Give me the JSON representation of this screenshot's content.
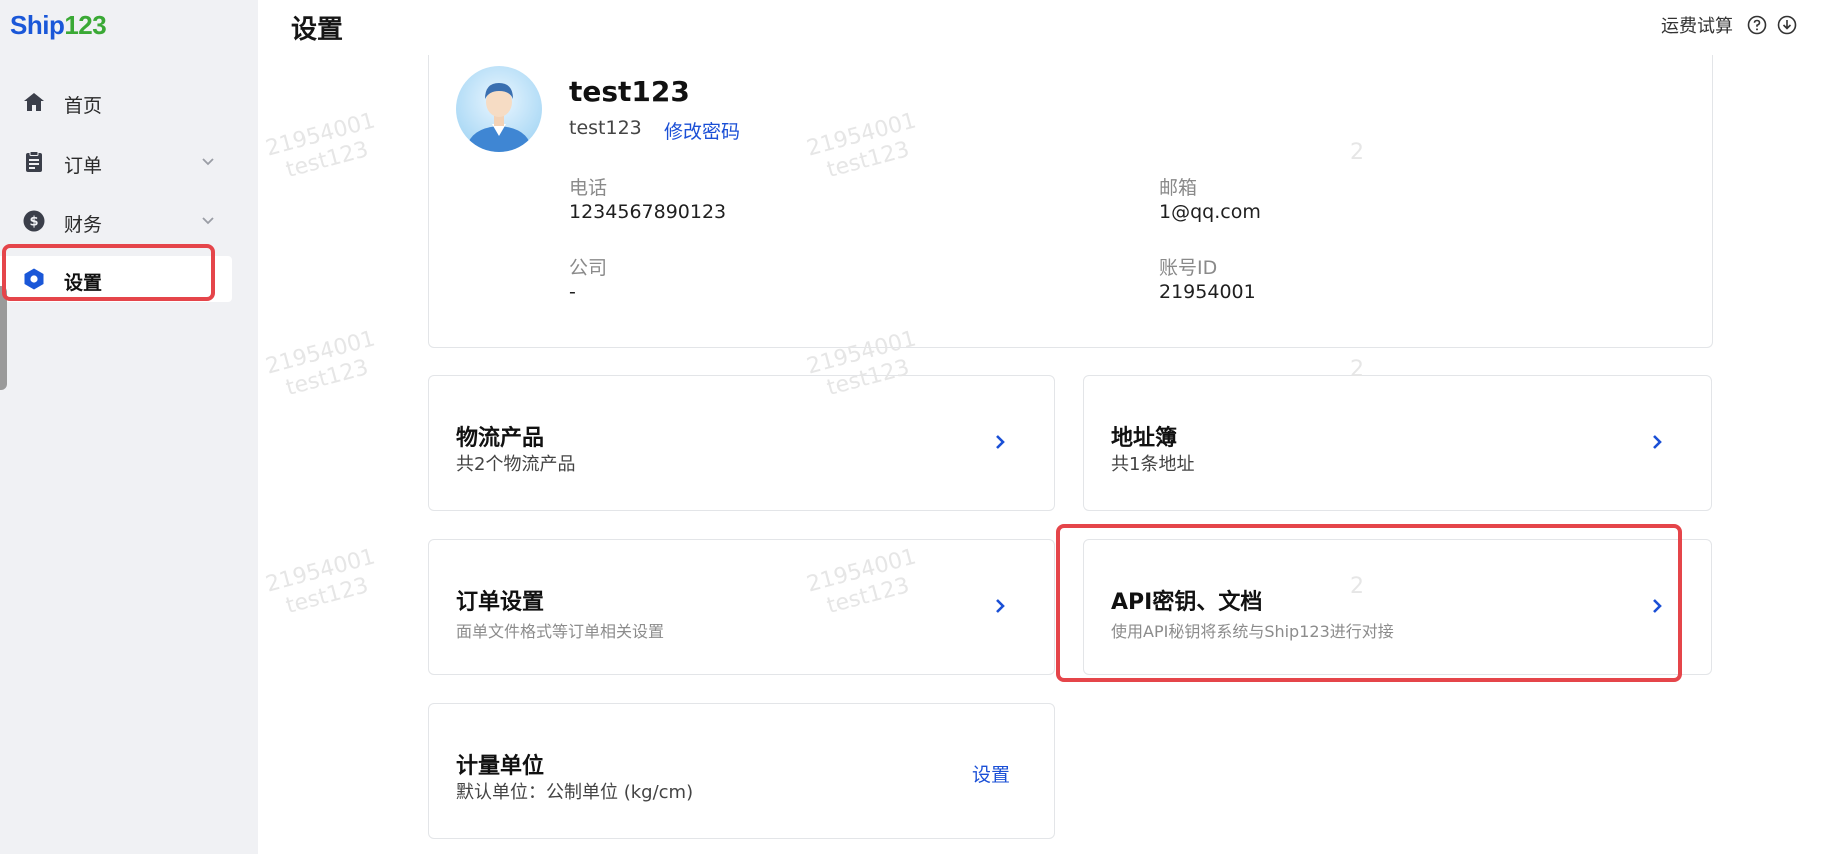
{
  "app": {
    "logo_ship": "Ship",
    "logo_num": "123",
    "brand_blue": "#1a57d8",
    "brand_green": "#3aa935",
    "accent": "#1a4fd6",
    "highlight_color": "#e5454a"
  },
  "sidebar": {
    "items": [
      {
        "label": "首页",
        "icon": "home-icon"
      },
      {
        "label": "订单",
        "icon": "clipboard-icon",
        "expandable": true
      },
      {
        "label": "财务",
        "icon": "dollar-icon",
        "expandable": true
      },
      {
        "label": "设置",
        "icon": "hexagon-settings-icon",
        "active": true
      }
    ]
  },
  "header": {
    "title": "设置",
    "freight_calc": "运费试算",
    "help_icon": "help-icon",
    "download_icon": "download-icon"
  },
  "watermark": {
    "id": "21954001",
    "user": "test123",
    "partial": "2"
  },
  "profile": {
    "name": "test123",
    "username": "test123",
    "change_password": "修改密码",
    "phone_label": "电话",
    "phone": "1234567890123",
    "email_label": "邮箱",
    "email": "1@qq.com",
    "company_label": "公司",
    "company": "-",
    "account_id_label": "账号ID",
    "account_id": "21954001"
  },
  "cards": {
    "logistics": {
      "title": "物流产品",
      "desc": "共2个物流产品"
    },
    "address": {
      "title": "地址簿",
      "desc": "共1条地址"
    },
    "order_settings": {
      "title": "订单设置",
      "desc": "面单文件格式等订单相关设置"
    },
    "api": {
      "title": "API密钥、文档",
      "desc": "使用API秘钥将系统与Ship123进行对接"
    },
    "units": {
      "title": "计量单位",
      "desc": "默认单位：公制单位 (kg/cm)",
      "action": "设置"
    }
  }
}
